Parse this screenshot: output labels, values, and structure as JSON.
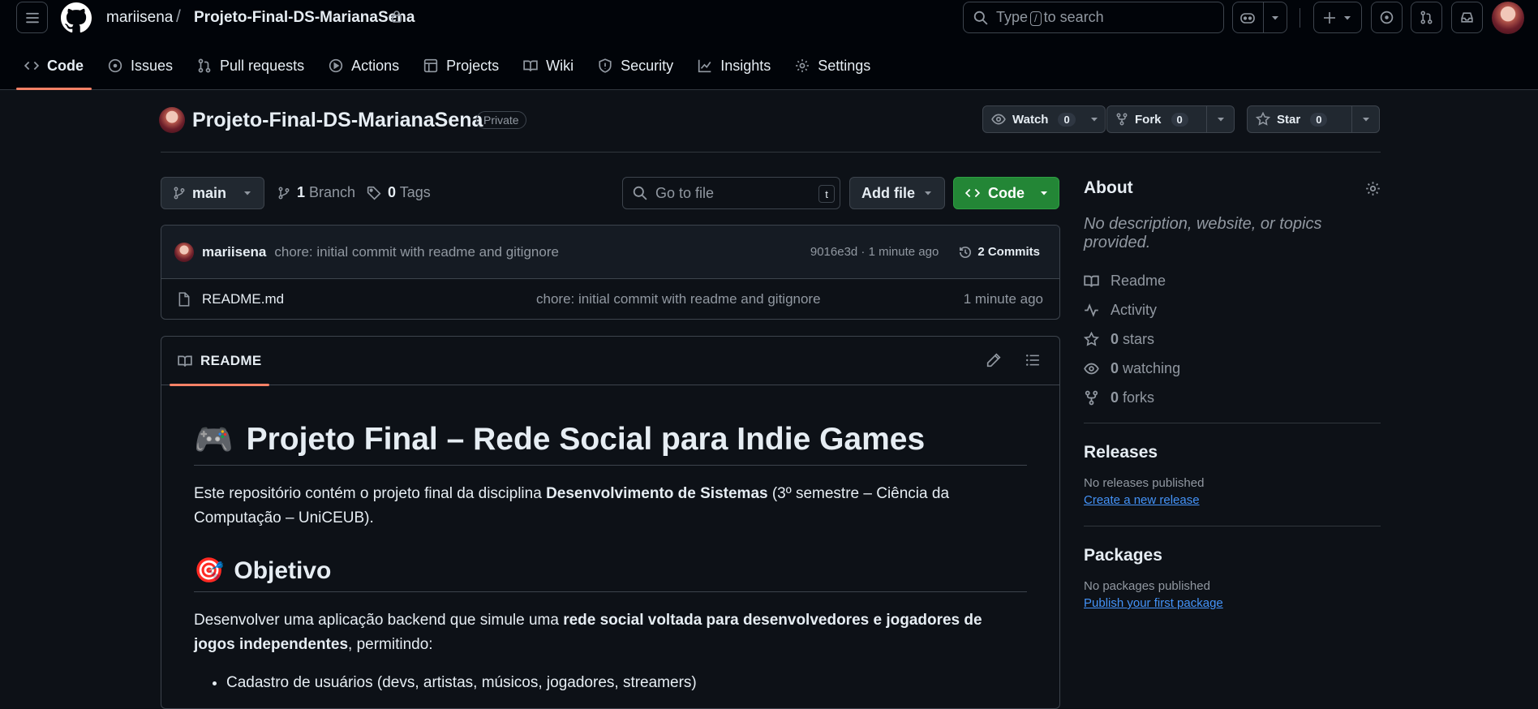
{
  "header": {
    "user": "mariisena",
    "separator": "/",
    "repo": "Projeto-Final-DS-MarianaSena",
    "search": {
      "type": "Type",
      "key": "/",
      "rest": "to search"
    }
  },
  "tabs": [
    {
      "label": "Code"
    },
    {
      "label": "Issues"
    },
    {
      "label": "Pull requests"
    },
    {
      "label": "Actions"
    },
    {
      "label": "Projects"
    },
    {
      "label": "Wiki"
    },
    {
      "label": "Security"
    },
    {
      "label": "Insights"
    },
    {
      "label": "Settings"
    }
  ],
  "repo": {
    "name": "Projeto-Final-DS-MarianaSena",
    "visibility": "Private",
    "watch": {
      "label": "Watch",
      "count": "0"
    },
    "fork": {
      "label": "Fork",
      "count": "0"
    },
    "star": {
      "label": "Star",
      "count": "0"
    }
  },
  "filenav": {
    "branch": "main",
    "branches_count": "1",
    "branches_label": "Branch",
    "tags_count": "0",
    "tags_label": "Tags",
    "go_to_file": "Go to file",
    "go_to_file_key": "t",
    "add_file": "Add file",
    "code": "Code"
  },
  "commit": {
    "author": "mariisena",
    "message": "chore: initial commit with readme and gitignore",
    "sha_time": "9016e3d · 1 minute ago",
    "commits": "2 Commits"
  },
  "files": [
    {
      "name": "README.md",
      "message": "chore: initial commit with readme and gitignore",
      "time": "1 minute ago"
    }
  ],
  "readme": {
    "tab": "README",
    "h1_emoji": "🎮",
    "h1": "Projeto Final – Rede Social para Indie Games",
    "p1_a": "Este repositório contém o projeto final da disciplina ",
    "p1_b": "Desenvolvimento de Sistemas",
    "p1_c": " (3º semestre – Ciência da Computação – UniCEUB).",
    "h2_emoji": "🎯",
    "h2": "Objetivo",
    "p2_a": "Desenvolver uma aplicação backend que simule uma ",
    "p2_b": "rede social voltada para desenvolvedores e jogadores de jogos independentes",
    "p2_c": ", permitindo:",
    "list": [
      "Cadastro de usuários (devs, artistas, músicos, jogadores, streamers)"
    ]
  },
  "about": {
    "title": "About",
    "description": "No description, website, or topics provided.",
    "readme": "Readme",
    "activity": "Activity",
    "stars_count": "0",
    "stars_label": "stars",
    "watching_count": "0",
    "watching_label": "watching",
    "forks_count": "0",
    "forks_label": "forks"
  },
  "releases": {
    "title": "Releases",
    "none": "No releases published",
    "link": "Create a new release"
  },
  "packages": {
    "title": "Packages",
    "none": "No packages published",
    "link": "Publish your first package"
  }
}
